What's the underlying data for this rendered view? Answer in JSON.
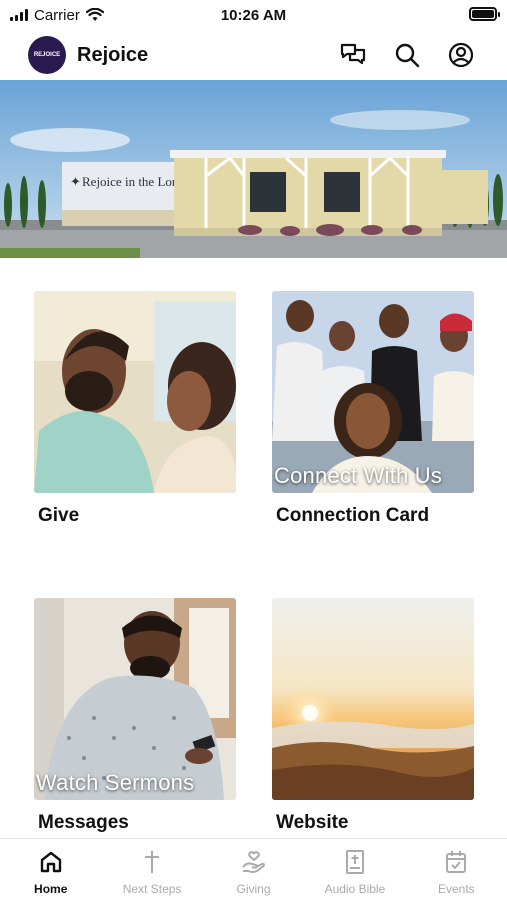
{
  "status_bar": {
    "carrier": "Carrier",
    "time": "10:26 AM"
  },
  "header": {
    "title": "Rejoice",
    "logo_text": "REJOICE",
    "actions": {
      "messages_icon": "chat-bubbles-icon",
      "search_icon": "search-icon",
      "profile_icon": "profile-icon"
    }
  },
  "hero": {
    "building_sign": "Rejoice in the Lord"
  },
  "tiles": [
    {
      "label": "Give",
      "overlay": ""
    },
    {
      "label": "Connection Card",
      "overlay": "Connect With Us"
    },
    {
      "label": "Messages",
      "overlay": "Watch Sermons"
    },
    {
      "label": "Website",
      "overlay": ""
    }
  ],
  "tab_bar": {
    "active": "Home",
    "tabs": [
      {
        "label": "Home",
        "icon": "home-icon"
      },
      {
        "label": "Next Steps",
        "icon": "cross-icon"
      },
      {
        "label": "Giving",
        "icon": "giving-hand-heart-icon"
      },
      {
        "label": "Audio Bible",
        "icon": "bible-icon"
      },
      {
        "label": "Events",
        "icon": "calendar-check-icon"
      }
    ]
  },
  "colors": {
    "logo_bg": "#2a1a4f",
    "active_tab": "#111111",
    "inactive_tab": "#aaaaaa"
  }
}
